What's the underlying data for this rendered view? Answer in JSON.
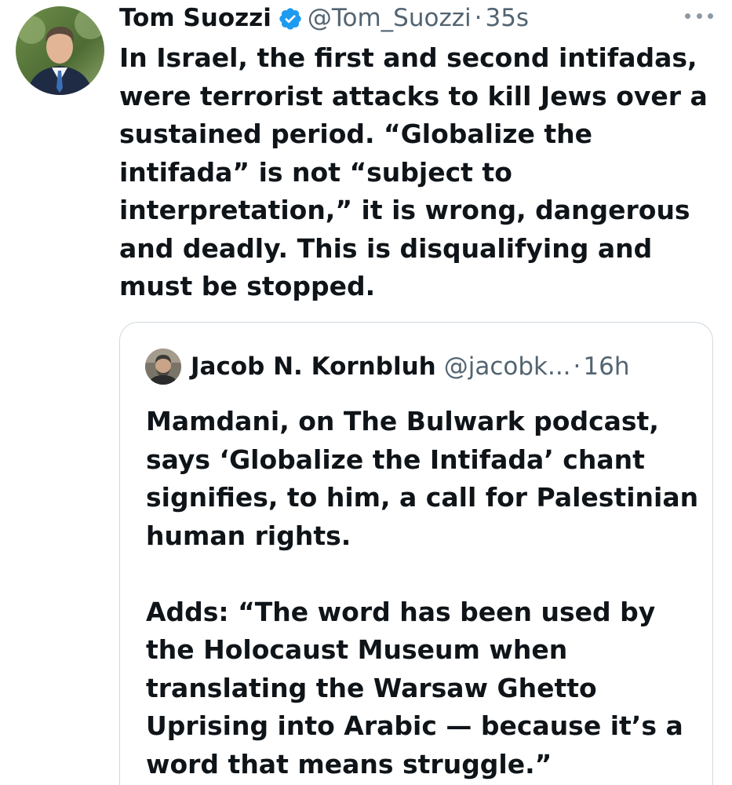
{
  "tweet": {
    "author_name": "Tom Suozzi",
    "handle": "@Tom_Suozzi",
    "separator": "·",
    "time": "35s",
    "verified_icon": "verified-badge-icon",
    "more_icon": "more-options-icon",
    "text": "In Israel, the first and second intifadas,\nwere terrorist attacks to kill Jews over a\nsustained period. “Globalize the\nintifada” is not “subject to\ninterpretation,” it is wrong, dangerous\nand deadly. This is disqualifying and\nmust be stopped."
  },
  "quoted_tweet": {
    "author_name": "Jacob N. Kornbluh",
    "handle": "@jacobk...",
    "separator": "·",
    "time": "16h",
    "text": "Mamdani, on The Bulwark podcast,\nsays ‘Globalize the Intifada’ chant\nsignifies, to him, a call for Palestinian\nhuman rights.\n\nAdds: “The word has been used by\nthe Holocaust Museum when\ntranslating the Warsaw Ghetto\nUprising into Arabic — because it’s a\nword that means struggle.”"
  },
  "colors": {
    "text_primary": "#0f1419",
    "text_secondary": "#536471",
    "verified_blue": "#1d9bf0",
    "border": "#cfd9de"
  }
}
